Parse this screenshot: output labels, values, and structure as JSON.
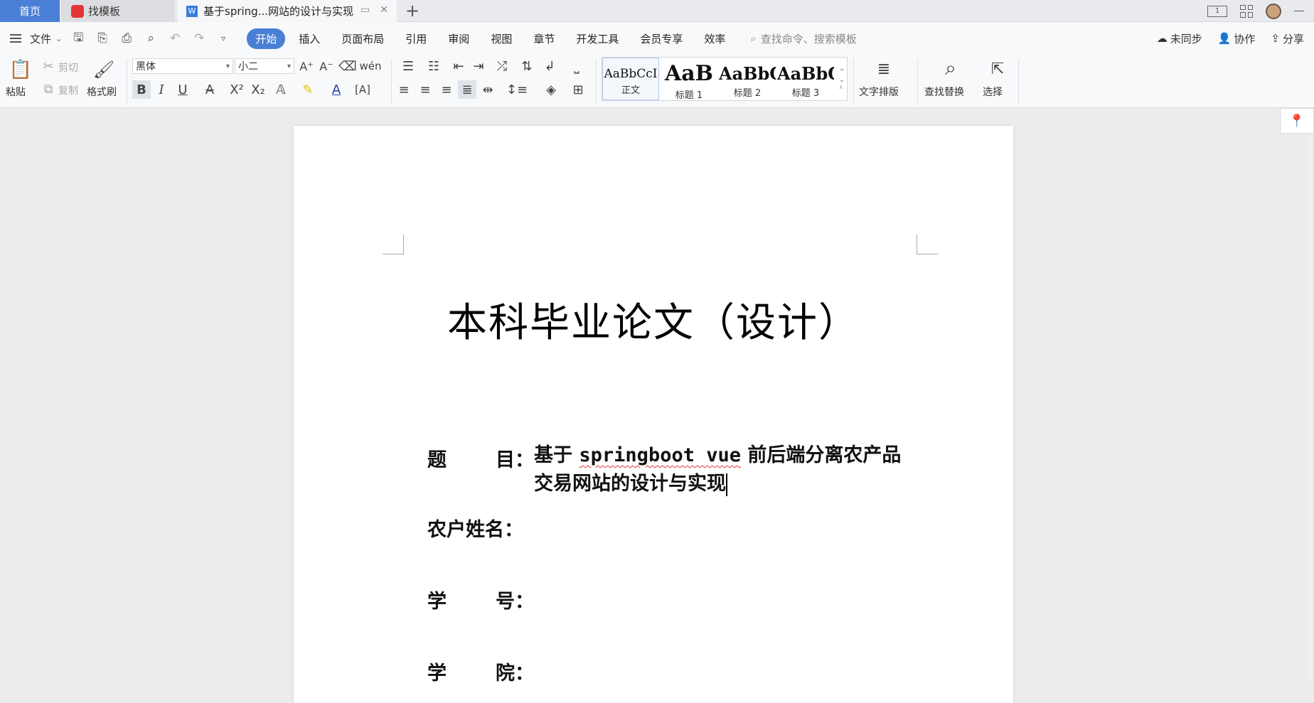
{
  "tabs": {
    "home": "首页",
    "templates": "找模板",
    "document": "基于spring...网站的设计与实现"
  },
  "menu": {
    "file": "文件",
    "tabs": [
      "开始",
      "插入",
      "页面布局",
      "引用",
      "审阅",
      "视图",
      "章节",
      "开发工具",
      "会员专享",
      "效率"
    ],
    "search_placeholder": "查找命令、搜索模板",
    "sync": "未同步",
    "collab": "协作",
    "share": "分享"
  },
  "ribbon": {
    "paste": "粘贴",
    "cut": "剪切",
    "copy": "复制",
    "format_painter": "格式刷",
    "font_name": "黑体",
    "font_size": "小二",
    "styles": [
      {
        "preview": "AaBbCcI",
        "name": "正文"
      },
      {
        "preview": "AaB",
        "name": "标题 1"
      },
      {
        "preview": "AaBbC",
        "name": "标题 2"
      },
      {
        "preview": "AaBbC",
        "name": "标题 3"
      }
    ],
    "text_layout": "文字排版",
    "find_replace": "查找替换",
    "select": "选择"
  },
  "document": {
    "title": "本科毕业论文（设计）",
    "fields": [
      {
        "key_a": "题",
        "key_b": "目：",
        "value_prefix": "基于 ",
        "value_mono": "springboot vue",
        "value_suffix": " 前后端分离农产品交易网站的设计与实现"
      },
      {
        "key": "农户姓名："
      },
      {
        "key_a": "学",
        "key_b": "号："
      },
      {
        "key_a": "学",
        "key_b": "院："
      }
    ]
  },
  "colors": {
    "accent": "#4a7fd6",
    "background": "#ececed"
  }
}
